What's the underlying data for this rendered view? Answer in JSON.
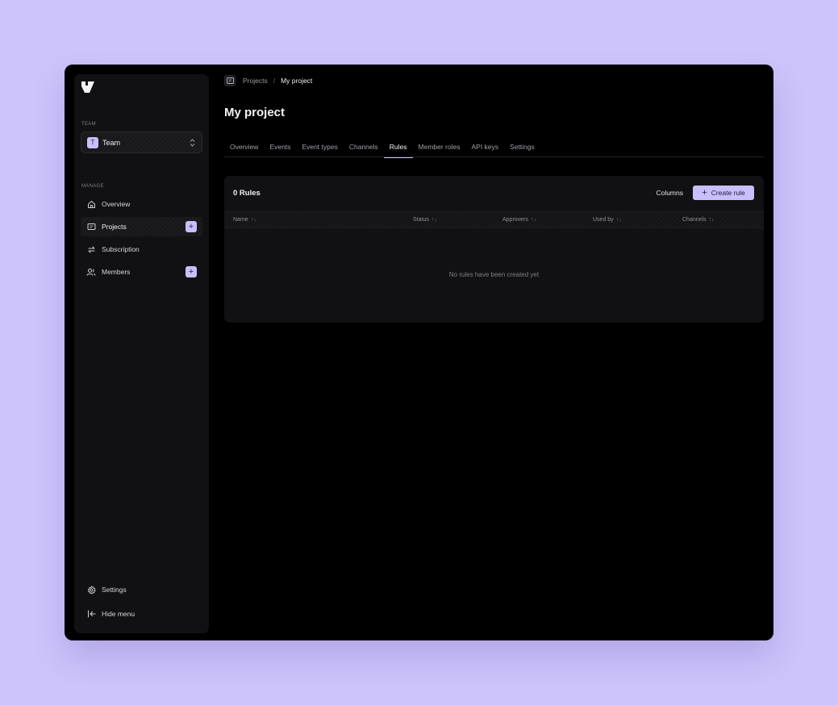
{
  "sidebar": {
    "team_section_label": "TEAM",
    "team": {
      "avatar_letter": "T",
      "name": "Team"
    },
    "manage_section_label": "MANAGE",
    "nav": [
      {
        "label": "Overview",
        "icon": "home-icon"
      },
      {
        "label": "Projects",
        "icon": "folder-icon",
        "has_add": true
      },
      {
        "label": "Subscription",
        "icon": "repeat-icon"
      },
      {
        "label": "Members",
        "icon": "users-icon",
        "has_add": true
      }
    ],
    "footer": [
      {
        "label": "Settings",
        "icon": "gear-icon"
      },
      {
        "label": "Hide menu",
        "icon": "collapse-icon"
      }
    ]
  },
  "breadcrumb": {
    "parent": "Projects",
    "separator": "/",
    "current": "My project"
  },
  "page_title": "My project",
  "tabs": [
    "Overview",
    "Events",
    "Event types",
    "Channels",
    "Rules",
    "Member roles",
    "API keys",
    "Settings"
  ],
  "active_tab": "Rules",
  "rules_card": {
    "title": "0 Rules",
    "columns_label": "Columns",
    "create_label": "Create rule",
    "headers": [
      "Name",
      "Status",
      "Approvers",
      "Used by",
      "Channels"
    ],
    "sort_glyph": "↑↓",
    "empty_message": "No rules have been created yet"
  },
  "colors": {
    "accent": "#c9bffb",
    "background": "#cdc4fb",
    "window": "#000000",
    "panel": "#111113"
  }
}
